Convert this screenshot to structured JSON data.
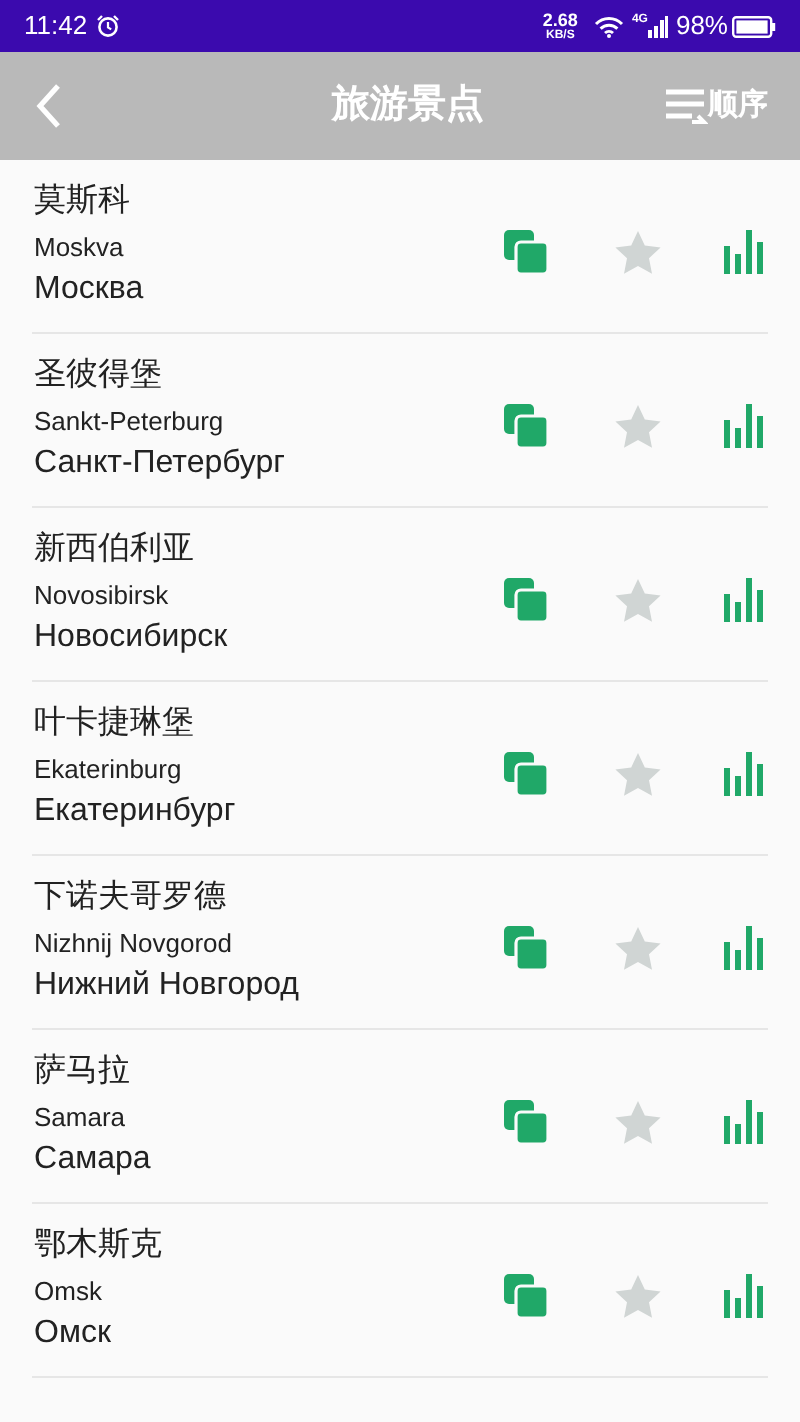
{
  "status_bar": {
    "time": "11:42",
    "speed": "2.68",
    "speed_unit": "KB/S",
    "network": "4G",
    "battery": "98%"
  },
  "header": {
    "title": "旅游景点",
    "sort_label": "顺序"
  },
  "cities": [
    {
      "chinese": "莫斯科",
      "latin": "Moskva",
      "russian": "Москва",
      "favorite": false
    },
    {
      "chinese": "圣彼得堡",
      "latin": "Sankt-Peterburg",
      "russian": "Санкт-Петербург",
      "favorite": false
    },
    {
      "chinese": "新西伯利亚",
      "latin": "Novosibirsk",
      "russian": "Новосибирск",
      "favorite": false
    },
    {
      "chinese": "叶卡捷琳堡",
      "latin": "Ekaterinburg",
      "russian": "Екатеринбург",
      "favorite": false
    },
    {
      "chinese": "下诺夫哥罗德",
      "latin": "Nizhnij Novgorod",
      "russian": "Нижний Новгород",
      "favorite": false
    },
    {
      "chinese": "萨马拉",
      "latin": "Samara",
      "russian": "Самара",
      "favorite": false
    },
    {
      "chinese": "鄂木斯克",
      "latin": "Omsk",
      "russian": "Омск",
      "favorite": false
    }
  ]
}
